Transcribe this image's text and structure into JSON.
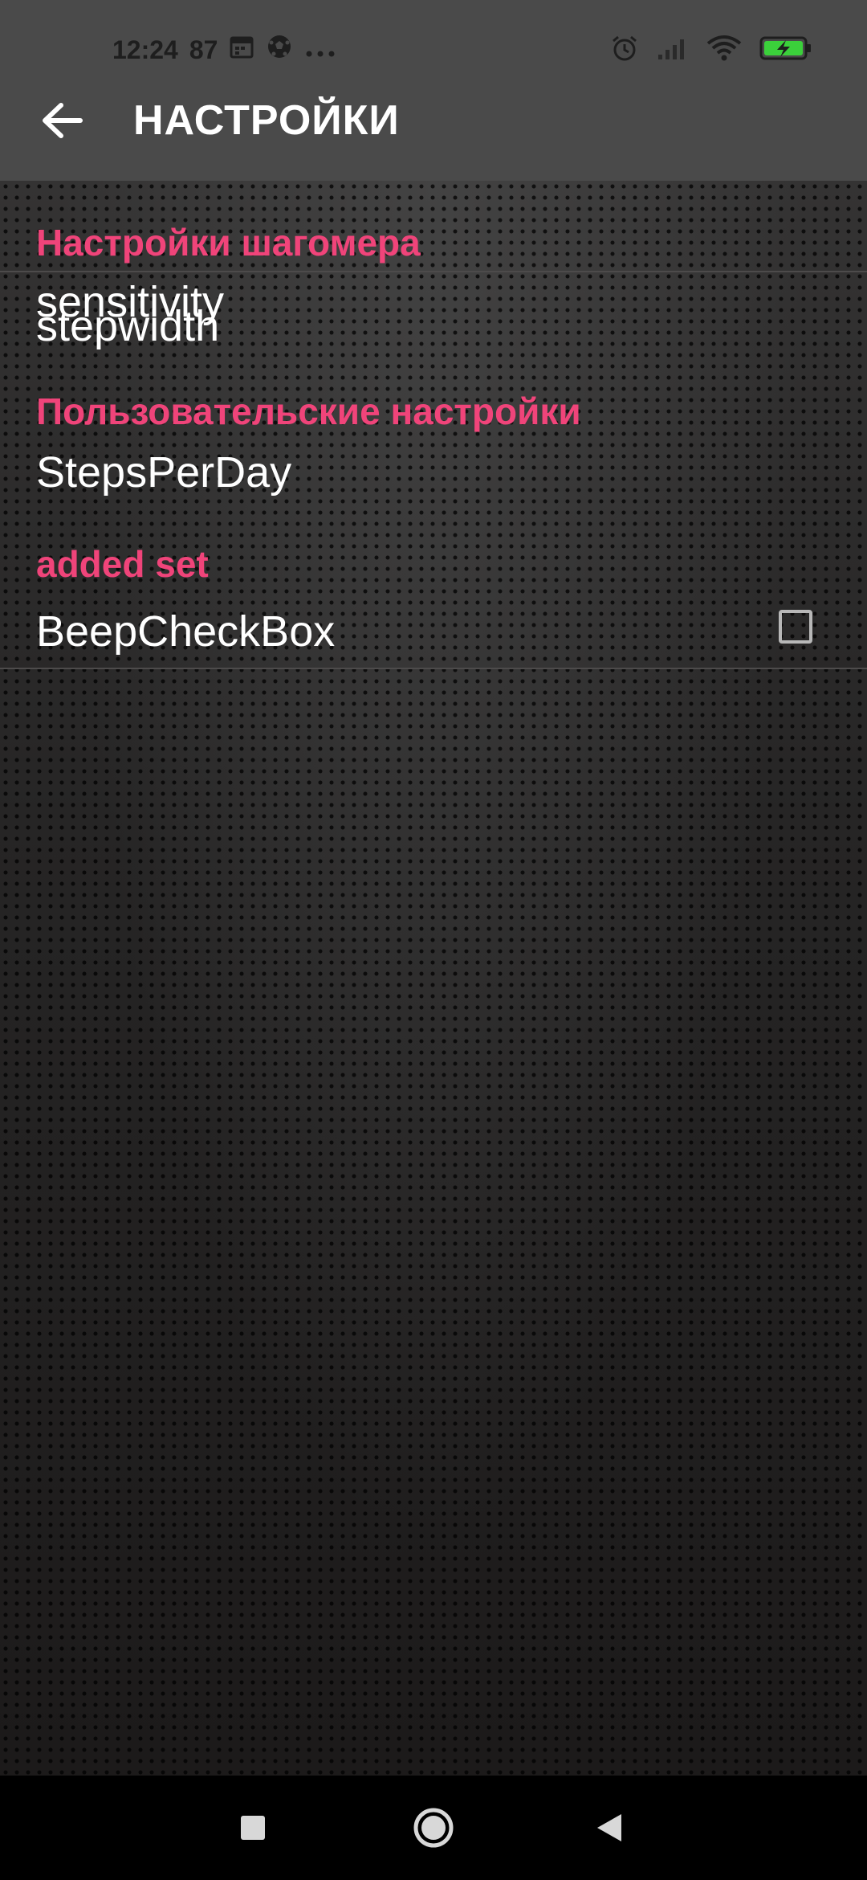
{
  "status_bar": {
    "time": "12:24",
    "notification_count": "87",
    "left_icons": [
      "calendar-icon",
      "soccer-ball-icon",
      "more-dots-icon"
    ],
    "right_icons": [
      "alarm-icon",
      "signal-icon",
      "wifi-icon",
      "battery-charging-icon"
    ],
    "battery_color": "#3bd03b"
  },
  "app_bar": {
    "title": "НАСТРОЙКИ",
    "back_icon": "arrow-left-icon"
  },
  "preferences": {
    "section_pedometer": "Настройки шагомера",
    "sensitivity": "sensitivity",
    "stepwidth": "stepwidth",
    "section_user": "Пользовательские настройки",
    "steps_per_day": "StepsPerDay",
    "section_added": "added set",
    "beep_checkbox": "BeepCheckBox",
    "beep_checked": false
  },
  "colors": {
    "accent": "#f0447a",
    "app_bar": "#4a4a4a",
    "text": "#ffffff"
  },
  "nav_bar": {
    "icons": [
      "recent-apps-icon",
      "home-icon",
      "back-icon"
    ]
  }
}
